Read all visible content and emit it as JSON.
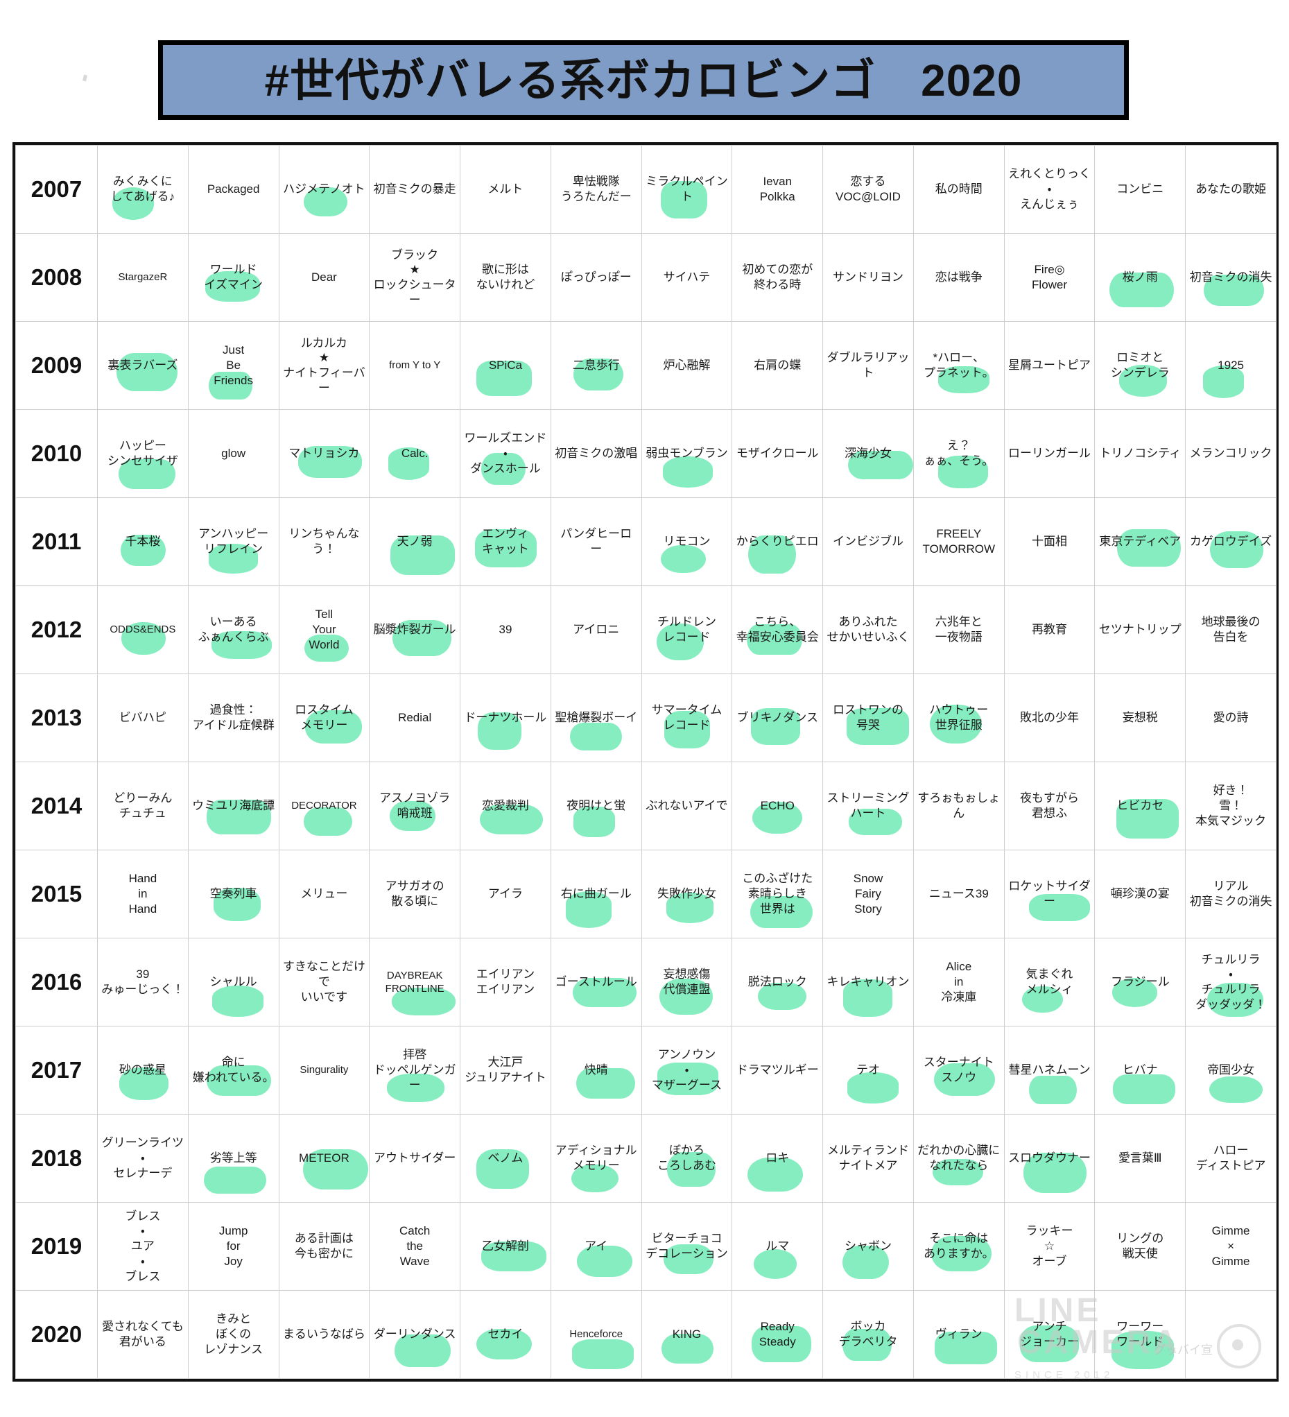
{
  "header": {
    "title": "#世代がバレる系ボカロビンゴ　2020",
    "title_bg": "#7f9cc6",
    "title_border": "#000000"
  },
  "theme": {
    "year_bg": "#c2d2ec",
    "highlight": "#86edc0",
    "grid_line": "#cfcfcf",
    "outer_border": "#111111"
  },
  "watermark": {
    "line1": "LINE",
    "line2": "CAMERA",
    "sub": "SINCE 2012",
    "extra": "グッバイ宣"
  },
  "grid": {
    "rows": [
      {
        "year": "2007",
        "cells": [
          {
            "t": "みくみくに\nしてあげる♪",
            "h": 1
          },
          {
            "t": "Packaged",
            "h": 0
          },
          {
            "t": "ハジメテノオト",
            "h": 1
          },
          {
            "t": "初音ミクの暴走",
            "h": 0
          },
          {
            "t": "メルト",
            "h": 0
          },
          {
            "t": "卑怯戦隊\nうろたんだー",
            "h": 0
          },
          {
            "t": "ミラクルペイント",
            "h": 1
          },
          {
            "t": "Ievan\nPolkka",
            "h": 0
          },
          {
            "t": "恋する\nVOC@LOID",
            "h": 0
          },
          {
            "t": "私の時間",
            "h": 0
          },
          {
            "t": "えれくとりっく\n・\nえんじぇぅ",
            "h": 0
          },
          {
            "t": "コンビニ",
            "h": 0
          },
          {
            "t": "あなたの歌姫",
            "h": 0
          }
        ]
      },
      {
        "year": "2008",
        "cells": [
          {
            "t": "StargazeR",
            "h": 0
          },
          {
            "t": "ワールド\nイズマイン",
            "h": 1
          },
          {
            "t": "Dear",
            "h": 0
          },
          {
            "t": "ブラック\n★\nロックシューター",
            "h": 0
          },
          {
            "t": "歌に形は\nないけれど",
            "h": 0
          },
          {
            "t": "ぽっぴっぽー",
            "h": 0
          },
          {
            "t": "サイハテ",
            "h": 0
          },
          {
            "t": "初めての恋が\n終わる時",
            "h": 0
          },
          {
            "t": "サンドリヨン",
            "h": 0
          },
          {
            "t": "恋は戦争",
            "h": 0
          },
          {
            "t": "Fire◎\nFlower",
            "h": 0
          },
          {
            "t": "桜ノ雨",
            "h": 1
          },
          {
            "t": "初音ミクの消失",
            "h": 1
          }
        ]
      },
      {
        "year": "2009",
        "cells": [
          {
            "t": "裏表ラバーズ",
            "h": 1
          },
          {
            "t": "Just\nBe\nFriends",
            "h": 1
          },
          {
            "t": "ルカルカ\n★\nナイトフィーバー",
            "h": 0
          },
          {
            "t": "from Y to Y",
            "h": 0
          },
          {
            "t": "SPiCa",
            "h": 1
          },
          {
            "t": "二息歩行",
            "h": 1
          },
          {
            "t": "炉心融解",
            "h": 0
          },
          {
            "t": "右肩の蝶",
            "h": 0
          },
          {
            "t": "ダブルラリアット",
            "h": 0
          },
          {
            "t": "*ハロー、\nプラネット。",
            "h": 1
          },
          {
            "t": "星屑ユートピア",
            "h": 0
          },
          {
            "t": "ロミオと\nシンデレラ",
            "h": 1
          },
          {
            "t": "1925",
            "h": 1
          }
        ]
      },
      {
        "year": "2010",
        "cells": [
          {
            "t": "ハッピー\nシンセサイザ",
            "h": 1
          },
          {
            "t": "glow",
            "h": 0
          },
          {
            "t": "マトリョシカ",
            "h": 1
          },
          {
            "t": "Calc.",
            "h": 1
          },
          {
            "t": "ワールズエンド\n・\nダンスホール",
            "h": 1
          },
          {
            "t": "初音ミクの激唱",
            "h": 0
          },
          {
            "t": "弱虫モンブラン",
            "h": 1
          },
          {
            "t": "モザイクロール",
            "h": 0
          },
          {
            "t": "深海少女",
            "h": 1
          },
          {
            "t": "え？\nぁぁ、そう。",
            "h": 1
          },
          {
            "t": "ローリンガール",
            "h": 0
          },
          {
            "t": "トリノコシティ",
            "h": 0
          },
          {
            "t": "メランコリック",
            "h": 0
          }
        ]
      },
      {
        "year": "2011",
        "cells": [
          {
            "t": "千本桜",
            "h": 1
          },
          {
            "t": "アンハッピー\nリフレイン",
            "h": 1
          },
          {
            "t": "リンちゃんなう！",
            "h": 0
          },
          {
            "t": "天ノ弱",
            "h": 1
          },
          {
            "t": "エンヴィ\nキャット",
            "h": 1
          },
          {
            "t": "パンダヒーロー",
            "h": 0
          },
          {
            "t": "リモコン",
            "h": 1
          },
          {
            "t": "からくりピエロ",
            "h": 1
          },
          {
            "t": "インビジブル",
            "h": 0
          },
          {
            "t": "FREELY\nTOMORROW",
            "h": 0
          },
          {
            "t": "十面相",
            "h": 0
          },
          {
            "t": "東京テディベア",
            "h": 1
          },
          {
            "t": "カゲロウデイズ",
            "h": 1
          }
        ]
      },
      {
        "year": "2012",
        "cells": [
          {
            "t": "ODDS&ENDS",
            "h": 1
          },
          {
            "t": "いーある\nふぁんくらぶ",
            "h": 1
          },
          {
            "t": "Tell\nYour\nWorld",
            "h": 1
          },
          {
            "t": "脳漿炸裂ガール",
            "h": 1
          },
          {
            "t": "39",
            "h": 0
          },
          {
            "t": "アイロニ",
            "h": 0
          },
          {
            "t": "チルドレン\nレコード",
            "h": 1
          },
          {
            "t": "こちら、\n幸福安心委員会",
            "h": 1
          },
          {
            "t": "ありふれた\nせかいせいふく",
            "h": 0
          },
          {
            "t": "六兆年と\n一夜物語",
            "h": 0
          },
          {
            "t": "再教育",
            "h": 0
          },
          {
            "t": "セツナトリップ",
            "h": 0
          },
          {
            "t": "地球最後の\n告白を",
            "h": 0
          }
        ]
      },
      {
        "year": "2013",
        "cells": [
          {
            "t": "ビバハピ",
            "h": 0
          },
          {
            "t": "過食性：\nアイドル症候群",
            "h": 0
          },
          {
            "t": "ロスタイム\nメモリー",
            "h": 1
          },
          {
            "t": "Redial",
            "h": 0
          },
          {
            "t": "ドーナツホール",
            "h": 1
          },
          {
            "t": "聖槍爆裂ボーイ",
            "h": 1
          },
          {
            "t": "サマータイム\nレコード",
            "h": 1
          },
          {
            "t": "ブリキノダンス",
            "h": 1
          },
          {
            "t": "ロストワンの\n号哭",
            "h": 1
          },
          {
            "t": "ハウトゥー\n世界征服",
            "h": 1
          },
          {
            "t": "敗北の少年",
            "h": 0
          },
          {
            "t": "妄想税",
            "h": 0
          },
          {
            "t": "愛の詩",
            "h": 0
          }
        ]
      },
      {
        "year": "2014",
        "cells": [
          {
            "t": "どりーみん\nチュチュ",
            "h": 0
          },
          {
            "t": "ウミユリ海底譚",
            "h": 1
          },
          {
            "t": "DECORATOR",
            "h": 1
          },
          {
            "t": "アスノヨゾラ\n哨戒班",
            "h": 1
          },
          {
            "t": "恋愛裁判",
            "h": 1
          },
          {
            "t": "夜明けと蛍",
            "h": 1
          },
          {
            "t": "ぶれないアイで",
            "h": 0
          },
          {
            "t": "ECHO",
            "h": 1
          },
          {
            "t": "ストリーミング\nハート",
            "h": 1
          },
          {
            "t": "すろぉもぉしょん",
            "h": 0
          },
          {
            "t": "夜もすがら\n君想ふ",
            "h": 0
          },
          {
            "t": "ヒビカセ",
            "h": 1
          },
          {
            "t": "好き！\n雪！\n本気マジック",
            "h": 0
          }
        ]
      },
      {
        "year": "2015",
        "cells": [
          {
            "t": "Hand\nin\nHand",
            "h": 0
          },
          {
            "t": "空奏列車",
            "h": 1
          },
          {
            "t": "メリュー",
            "h": 0
          },
          {
            "t": "アサガオの\n散る頃に",
            "h": 0
          },
          {
            "t": "アイラ",
            "h": 0
          },
          {
            "t": "右に曲ガール",
            "h": 1
          },
          {
            "t": "失敗作少女",
            "h": 1
          },
          {
            "t": "このふざけた\n素晴らしき\n世界は",
            "h": 1
          },
          {
            "t": "Snow\nFairy\nStory",
            "h": 0
          },
          {
            "t": "ニュース39",
            "h": 0
          },
          {
            "t": "ロケットサイダー",
            "h": 1
          },
          {
            "t": "頓珍漢の宴",
            "h": 0
          },
          {
            "t": "リアル\n初音ミクの消失",
            "h": 0
          }
        ]
      },
      {
        "year": "2016",
        "cells": [
          {
            "t": "39\nみゅーじっく！",
            "h": 0
          },
          {
            "t": "シャルル",
            "h": 1
          },
          {
            "t": "すきなことだけで\nいいです",
            "h": 0
          },
          {
            "t": "DAYBREAK\nFRONTLINE",
            "h": 1
          },
          {
            "t": "エイリアン\nエイリアン",
            "h": 0
          },
          {
            "t": "ゴーストルール",
            "h": 1
          },
          {
            "t": "妄想感傷\n代償連盟",
            "h": 1
          },
          {
            "t": "脱法ロック",
            "h": 1
          },
          {
            "t": "キレキャリオン",
            "h": 1
          },
          {
            "t": "Alice\nin\n冷凍庫",
            "h": 0
          },
          {
            "t": "気まぐれ\nメルシィ",
            "h": 1
          },
          {
            "t": "フラジール",
            "h": 1
          },
          {
            "t": "チュルリラ\n・\nチュルリラ\nダッダッダ！",
            "h": 1
          }
        ]
      },
      {
        "year": "2017",
        "cells": [
          {
            "t": "砂の惑星",
            "h": 1
          },
          {
            "t": "命に\n嫌われている。",
            "h": 1
          },
          {
            "t": "Singurality",
            "h": 0
          },
          {
            "t": "拝啓\nドッペルゲンガー",
            "h": 1
          },
          {
            "t": "大江戸\nジュリアナイト",
            "h": 0
          },
          {
            "t": "快晴",
            "h": 1
          },
          {
            "t": "アンノウン\n・\nマザーグース",
            "h": 1
          },
          {
            "t": "ドラマツルギー",
            "h": 0
          },
          {
            "t": "テオ",
            "h": 1
          },
          {
            "t": "スターナイト\nスノウ",
            "h": 1
          },
          {
            "t": "彗星ハネムーン",
            "h": 1
          },
          {
            "t": "ヒバナ",
            "h": 1
          },
          {
            "t": "帝国少女",
            "h": 1
          }
        ]
      },
      {
        "year": "2018",
        "cells": [
          {
            "t": "グリーンライツ\n・\nセレナーデ",
            "h": 0
          },
          {
            "t": "劣等上等",
            "h": 1
          },
          {
            "t": "METEOR",
            "h": 1
          },
          {
            "t": "アウトサイダー",
            "h": 0
          },
          {
            "t": "ベノム",
            "h": 1
          },
          {
            "t": "アディショナル\nメモリー",
            "h": 1
          },
          {
            "t": "ぼかろ\nころしあむ",
            "h": 1
          },
          {
            "t": "ロキ",
            "h": 1
          },
          {
            "t": "メルティランド\nナイトメア",
            "h": 0
          },
          {
            "t": "だれかの心臓に\nなれたなら",
            "h": 1
          },
          {
            "t": "スロウダウナー",
            "h": 1
          },
          {
            "t": "愛言葉Ⅲ",
            "h": 0
          },
          {
            "t": "ハロー\nディストピア",
            "h": 0
          }
        ]
      },
      {
        "year": "2019",
        "cells": [
          {
            "t": "ブレス\n・\nユア\n・\nブレス",
            "h": 0
          },
          {
            "t": "Jump\nfor\nJoy",
            "h": 0
          },
          {
            "t": "ある計画は\n今も密かに",
            "h": 0
          },
          {
            "t": "Catch\nthe\nWave",
            "h": 0
          },
          {
            "t": "乙女解剖",
            "h": 1
          },
          {
            "t": "アイ",
            "h": 1
          },
          {
            "t": "ビターチョコ\nデコレーション",
            "h": 1
          },
          {
            "t": "ルマ",
            "h": 1
          },
          {
            "t": "シャボン",
            "h": 1
          },
          {
            "t": "そこに命は\nありますか。",
            "h": 1
          },
          {
            "t": "ラッキー\n☆\nオーブ",
            "h": 0
          },
          {
            "t": "リングの\n戦天使",
            "h": 0
          },
          {
            "t": "Gimme\n×\nGimme",
            "h": 0
          }
        ]
      },
      {
        "year": "2020",
        "cells": [
          {
            "t": "愛されなくても\n君がいる",
            "h": 0
          },
          {
            "t": "きみと\nぼくの\nレゾナンス",
            "h": 0
          },
          {
            "t": "まるいうなばら",
            "h": 0
          },
          {
            "t": "ダーリンダンス",
            "h": 1
          },
          {
            "t": "セカイ",
            "h": 1
          },
          {
            "t": "Henceforce",
            "h": 1
          },
          {
            "t": "KING",
            "h": 1
          },
          {
            "t": "Ready\nSteady",
            "h": 1
          },
          {
            "t": "ボッカ\nデラベリタ",
            "h": 1
          },
          {
            "t": "ヴィラン",
            "h": 1
          },
          {
            "t": "アンチ\nジョーカー",
            "h": 1
          },
          {
            "t": "ワーワー\nワールド",
            "h": 1
          },
          {
            "t": "",
            "h": 0
          }
        ]
      }
    ]
  }
}
